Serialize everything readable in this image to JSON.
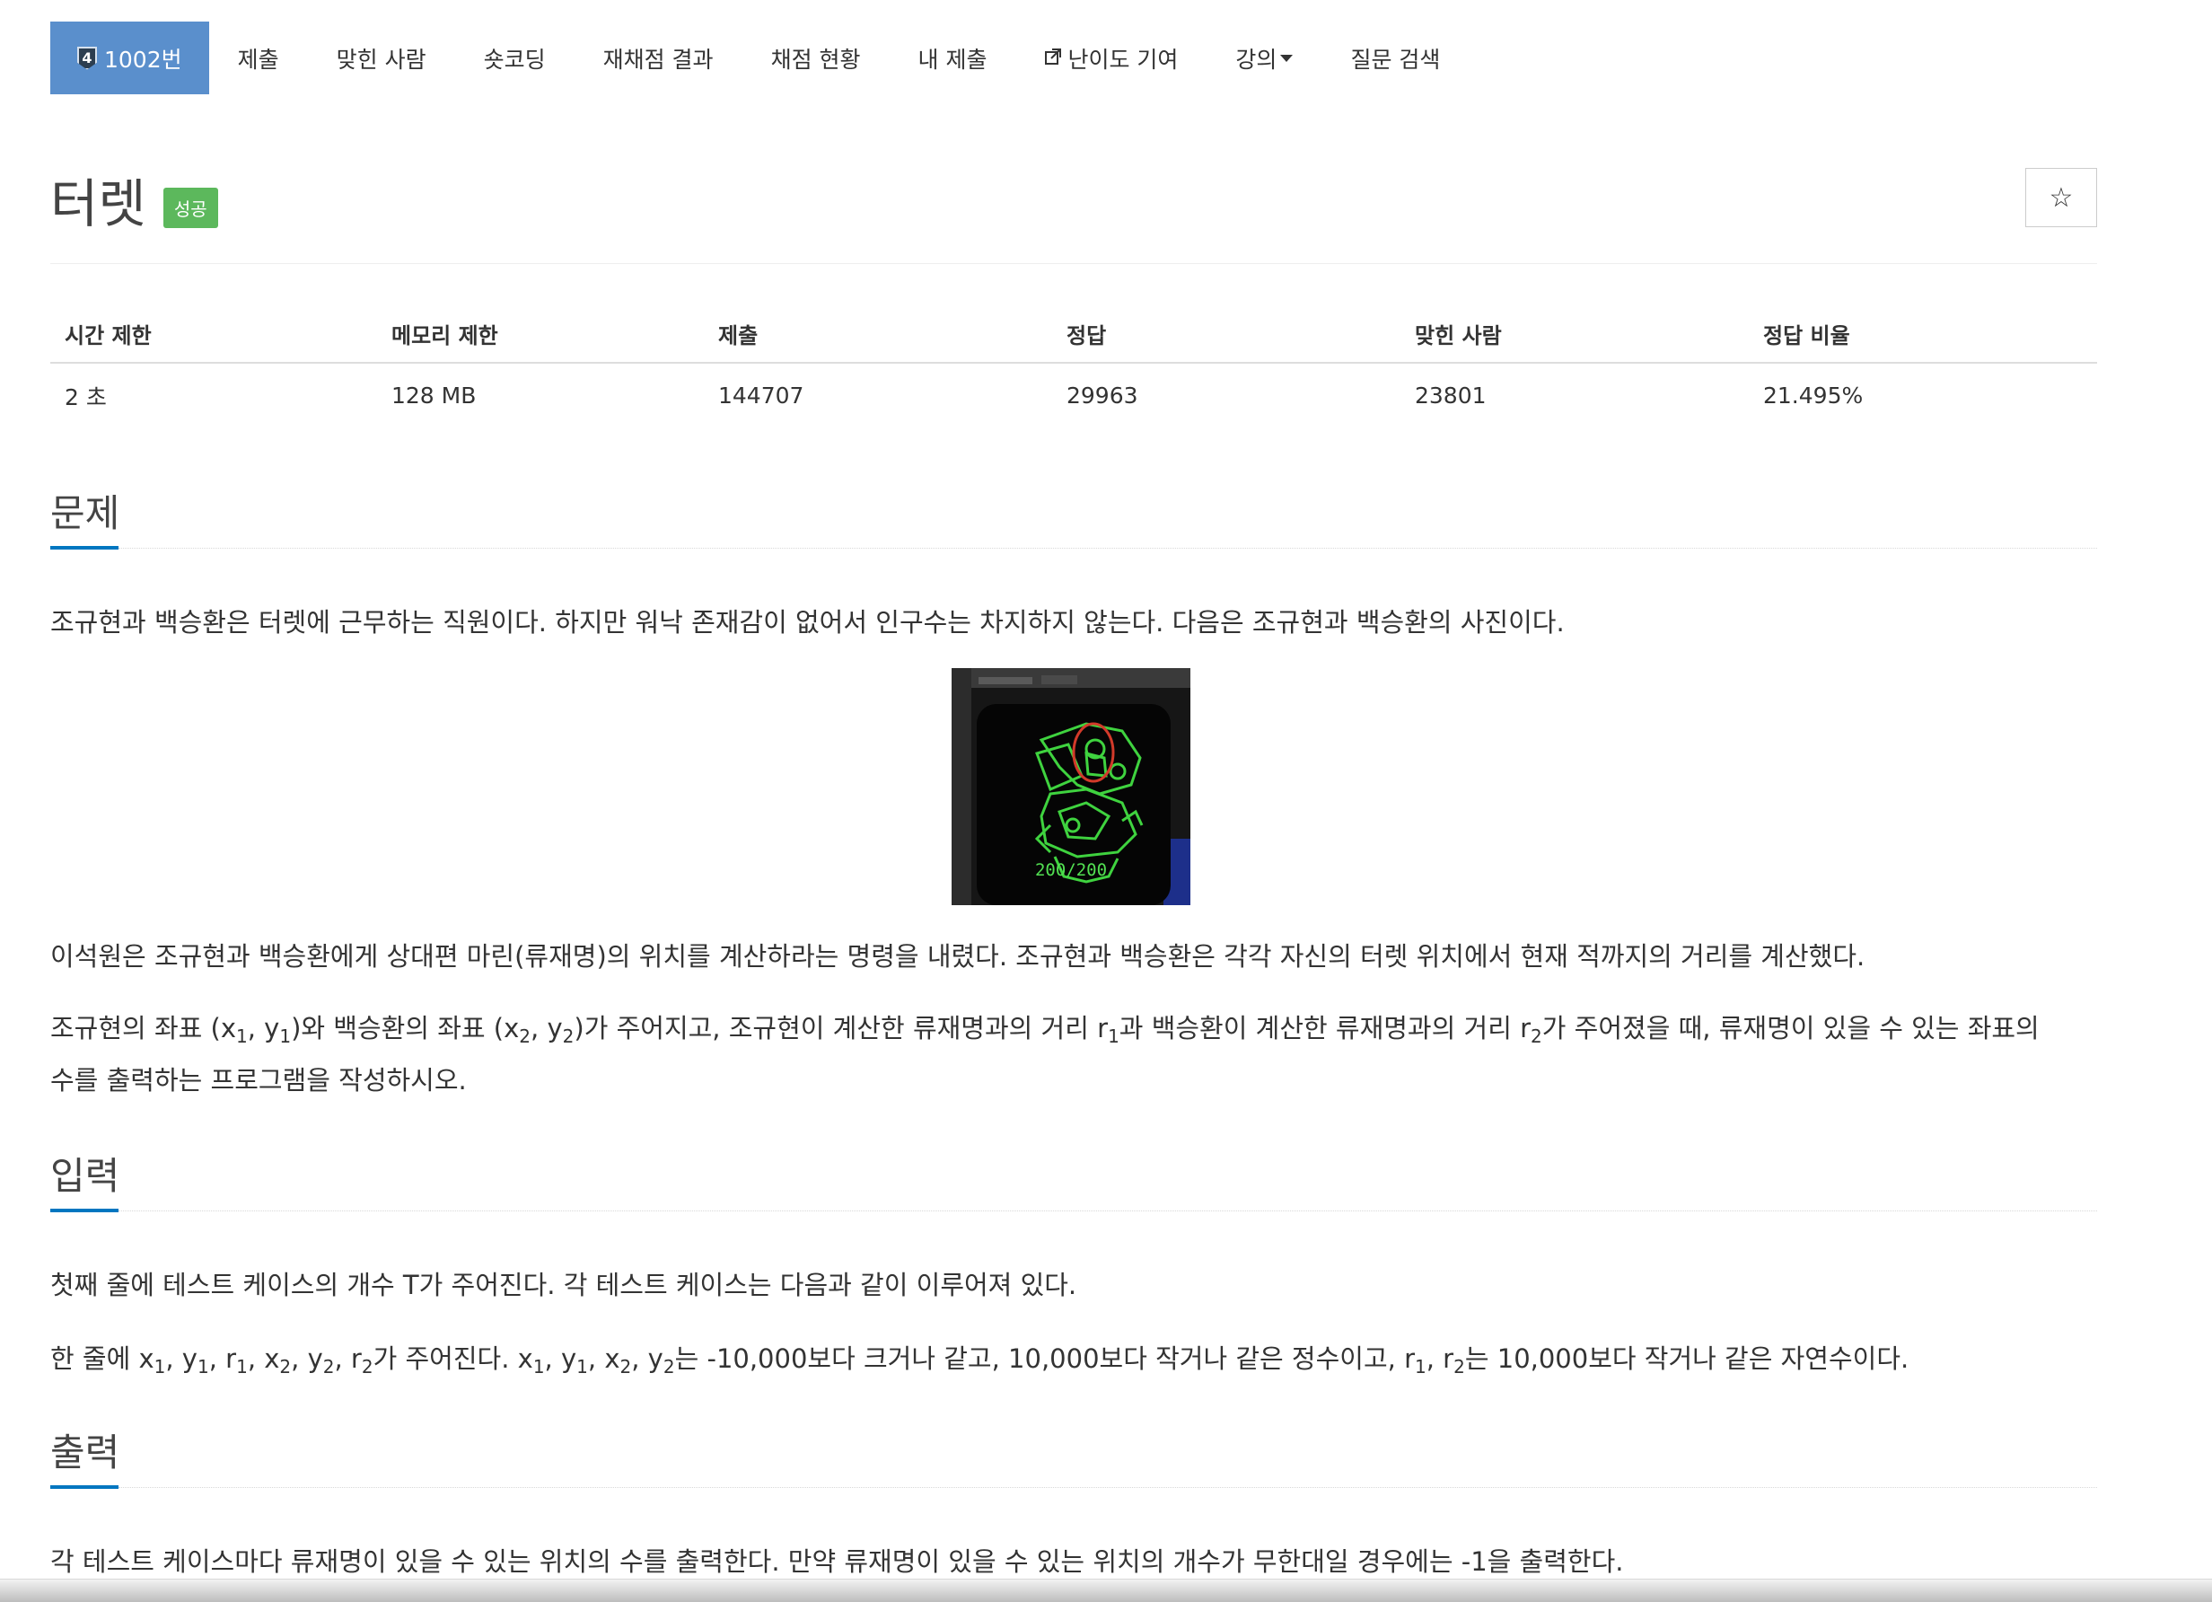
{
  "nav": {
    "problem_tier": "4",
    "problem_label": "1002번",
    "items": [
      "제출",
      "맞힌 사람",
      "숏코딩",
      "재채점 결과",
      "채점 현황",
      "내 제출",
      "난이도 기여",
      "강의",
      "질문 검색"
    ]
  },
  "title": "터렛",
  "result_badge": "성공",
  "star_icon": "☆",
  "info": {
    "headers": [
      "시간 제한",
      "메모리 제한",
      "제출",
      "정답",
      "맞힌 사람",
      "정답 비율"
    ],
    "values": [
      "2 초",
      "128 MB",
      "144707",
      "29963",
      "23801",
      "21.495%"
    ]
  },
  "sections": {
    "problem": "문제",
    "input": "입력",
    "output": "출력"
  },
  "problem": {
    "p1": "조규현과 백승환은 터렛에 근무하는 직원이다. 하지만 워낙 존재감이 없어서 인구수는 차지하지 않는다. 다음은 조규현과 백승환의 사진이다.",
    "image_caption": "200/200",
    "p2": "이석원은 조규현과 백승환에게 상대편 마린(류재명)의 위치를 계산하라는 명령을 내렸다. 조규현과 백승환은 각각 자신의 터렛 위치에서 현재 적까지의 거리를 계산했다.",
    "p3": {
      "a": "조규현의 좌표 (x",
      "b": ", y",
      "c": ")와 백승환의 좌표 (x",
      "d": ", y",
      "e": ")가 주어지고, 조규현이 계산한 류재명과의 거리 r",
      "f": "과 백승환이 계산한 류재명과의 거리 r",
      "g": "가 주어졌을 때, 류재명이 있을 수 있는 좌표의",
      "h": "수를 출력하는 프로그램을 작성하시오."
    }
  },
  "input": {
    "p1": "첫째 줄에 테스트 케이스의 개수 T가 주어진다. 각 테스트 케이스는 다음과 같이 이루어져 있다.",
    "p2": {
      "a": "한 줄에 x",
      "b": ", y",
      "c": ", r",
      "d": ", x",
      "e": ", y",
      "f": ", r",
      "g": "가 주어진다. x",
      "h": ", y",
      "i": ", x",
      "j": ", y",
      "k": "는 -10,000보다 크거나 같고, 10,000보다 작거나 같은 정수이고, r",
      "l": ", r",
      "m": "는 10,000보다 작거나 같은 자연수이다."
    }
  },
  "output": {
    "p1": "각 테스트 케이스마다 류재명이 있을 수 있는 위치의 수를 출력한다. 만약 류재명이 있을 수 있는 위치의 개수가 무한대일 경우에는 -1을 출력한다."
  },
  "sub": {
    "one": "1",
    "two": "2"
  },
  "icons": {
    "tier": "tier-badge-icon",
    "external": "external-link-icon",
    "caret": "caret-down-icon",
    "star": "star-icon"
  },
  "colors": {
    "active_tab": "#5a8fcc",
    "success": "#5cb85c",
    "section_underline": "#0076c0"
  }
}
